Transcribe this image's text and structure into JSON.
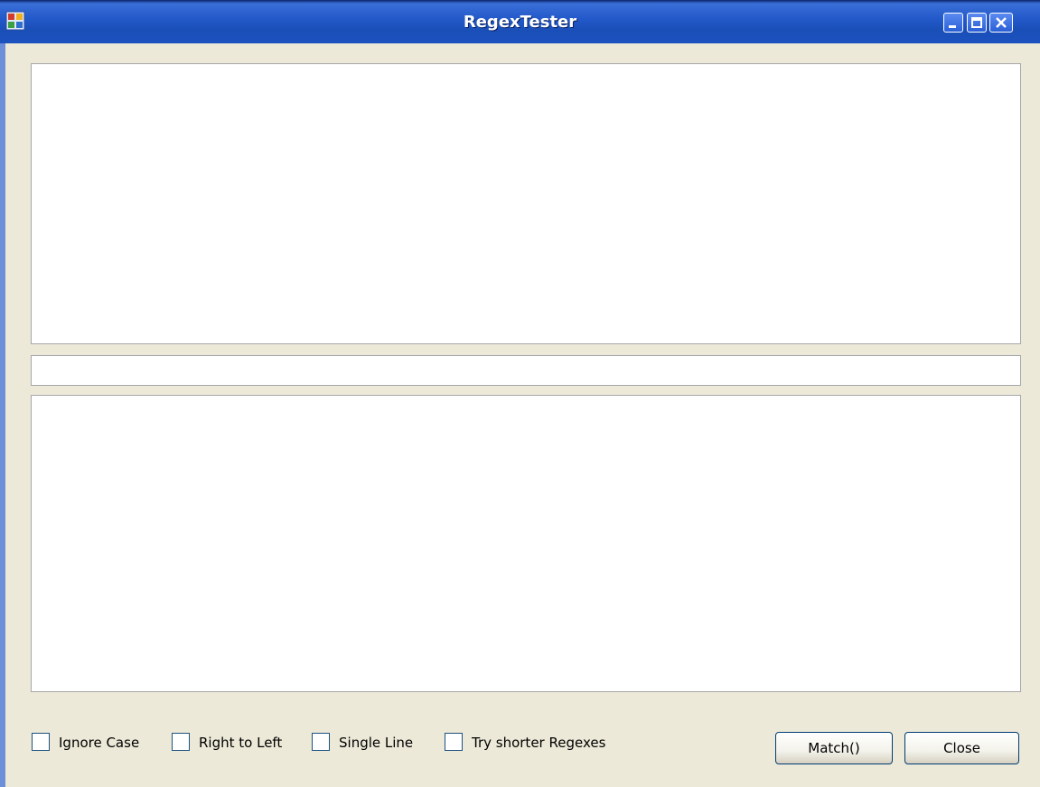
{
  "window": {
    "title": "RegexTester"
  },
  "icons": {
    "app": "app-icon",
    "minimize": "minimize-icon",
    "maximize": "maximize-icon",
    "close": "close-icon",
    "scroll_up": "chevron-up-icon",
    "scroll_down": "chevron-down-icon"
  },
  "options": [
    {
      "label": "Ignore Case",
      "checked": false
    },
    {
      "label": "Right to Left",
      "checked": false
    },
    {
      "label": "Single Line",
      "checked": false
    },
    {
      "label": "Try shorter Regexes",
      "checked": false
    }
  ],
  "buttons": {
    "match_label": "Match()",
    "close_label": "Close"
  },
  "inputs": {
    "source_text": "",
    "pattern": "",
    "results": ""
  }
}
